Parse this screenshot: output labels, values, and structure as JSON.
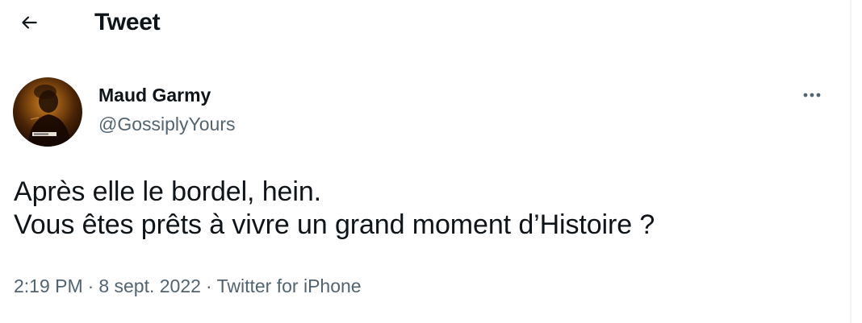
{
  "header": {
    "title": "Tweet"
  },
  "tweet": {
    "author": {
      "name": "Maud Garmy",
      "handle": "@GossiplyYours"
    },
    "text_lines": [
      "Après elle le bordel, hein.",
      "Vous êtes prêts à vivre un grand moment d’Histoire ?"
    ],
    "meta": {
      "time": "2:19 PM",
      "separator": "·",
      "date": "8 sept. 2022",
      "source": "Twitter for iPhone"
    }
  },
  "icons": {
    "back": "arrow-left-icon",
    "more": "more-horizontal-icon"
  },
  "colors": {
    "text_primary": "#0f1419",
    "text_secondary": "#536471",
    "background": "#ffffff",
    "divider": "#eff3f4"
  }
}
